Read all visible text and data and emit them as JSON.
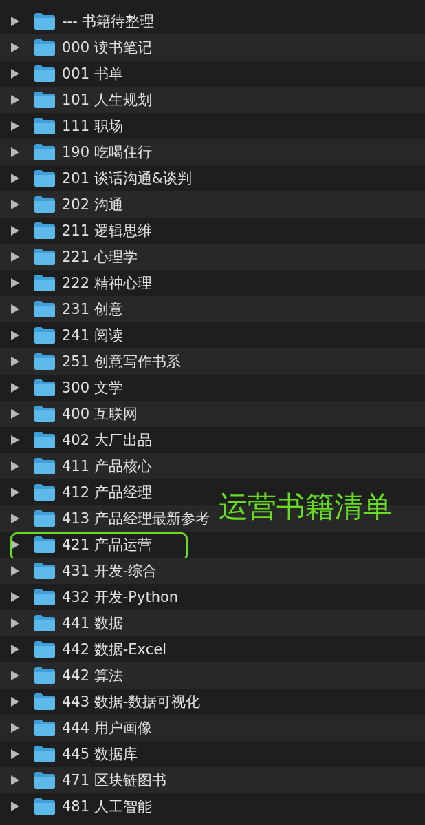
{
  "folders": [
    {
      "name": "--- 书籍待整理",
      "expanded": false,
      "highlighted": false
    },
    {
      "name": "000 读书笔记",
      "expanded": false,
      "highlighted": false
    },
    {
      "name": "001 书单",
      "expanded": false,
      "highlighted": false
    },
    {
      "name": "101 人生规划",
      "expanded": false,
      "highlighted": false
    },
    {
      "name": "111 职场",
      "expanded": false,
      "highlighted": false
    },
    {
      "name": "190 吃喝住行",
      "expanded": false,
      "highlighted": false
    },
    {
      "name": "201 谈话沟通&谈判",
      "expanded": false,
      "highlighted": false
    },
    {
      "name": "202 沟通",
      "expanded": false,
      "highlighted": false
    },
    {
      "name": "211 逻辑思维",
      "expanded": false,
      "highlighted": false
    },
    {
      "name": "221 心理学",
      "expanded": false,
      "highlighted": false
    },
    {
      "name": "222 精神心理",
      "expanded": false,
      "highlighted": false
    },
    {
      "name": "231 创意",
      "expanded": false,
      "highlighted": false
    },
    {
      "name": "241 阅读",
      "expanded": false,
      "highlighted": false
    },
    {
      "name": "251 创意写作书系",
      "expanded": false,
      "highlighted": false
    },
    {
      "name": "300 文学",
      "expanded": false,
      "highlighted": false
    },
    {
      "name": "400 互联网",
      "expanded": false,
      "highlighted": false
    },
    {
      "name": "402 大厂出品",
      "expanded": false,
      "highlighted": false
    },
    {
      "name": "411 产品核心",
      "expanded": false,
      "highlighted": false
    },
    {
      "name": "412 产品经理",
      "expanded": false,
      "highlighted": false
    },
    {
      "name": "413 产品经理最新参考",
      "expanded": false,
      "highlighted": false
    },
    {
      "name": "421 产品运营",
      "expanded": false,
      "highlighted": true
    },
    {
      "name": "431 开发-综合",
      "expanded": false,
      "highlighted": false
    },
    {
      "name": "432 开发-Python",
      "expanded": false,
      "highlighted": false
    },
    {
      "name": "441 数据",
      "expanded": false,
      "highlighted": false
    },
    {
      "name": "442 数据-Excel",
      "expanded": false,
      "highlighted": false
    },
    {
      "name": "442 算法",
      "expanded": false,
      "highlighted": false
    },
    {
      "name": "443 数据-数据可视化",
      "expanded": false,
      "highlighted": false
    },
    {
      "name": "444 用户画像",
      "expanded": false,
      "highlighted": false
    },
    {
      "name": "445 数据库",
      "expanded": false,
      "highlighted": false
    },
    {
      "name": "471 区块链图书",
      "expanded": false,
      "highlighted": false
    },
    {
      "name": "481 人工智能",
      "expanded": false,
      "highlighted": false
    }
  ],
  "annotation": {
    "label": "运营书籍清单"
  }
}
